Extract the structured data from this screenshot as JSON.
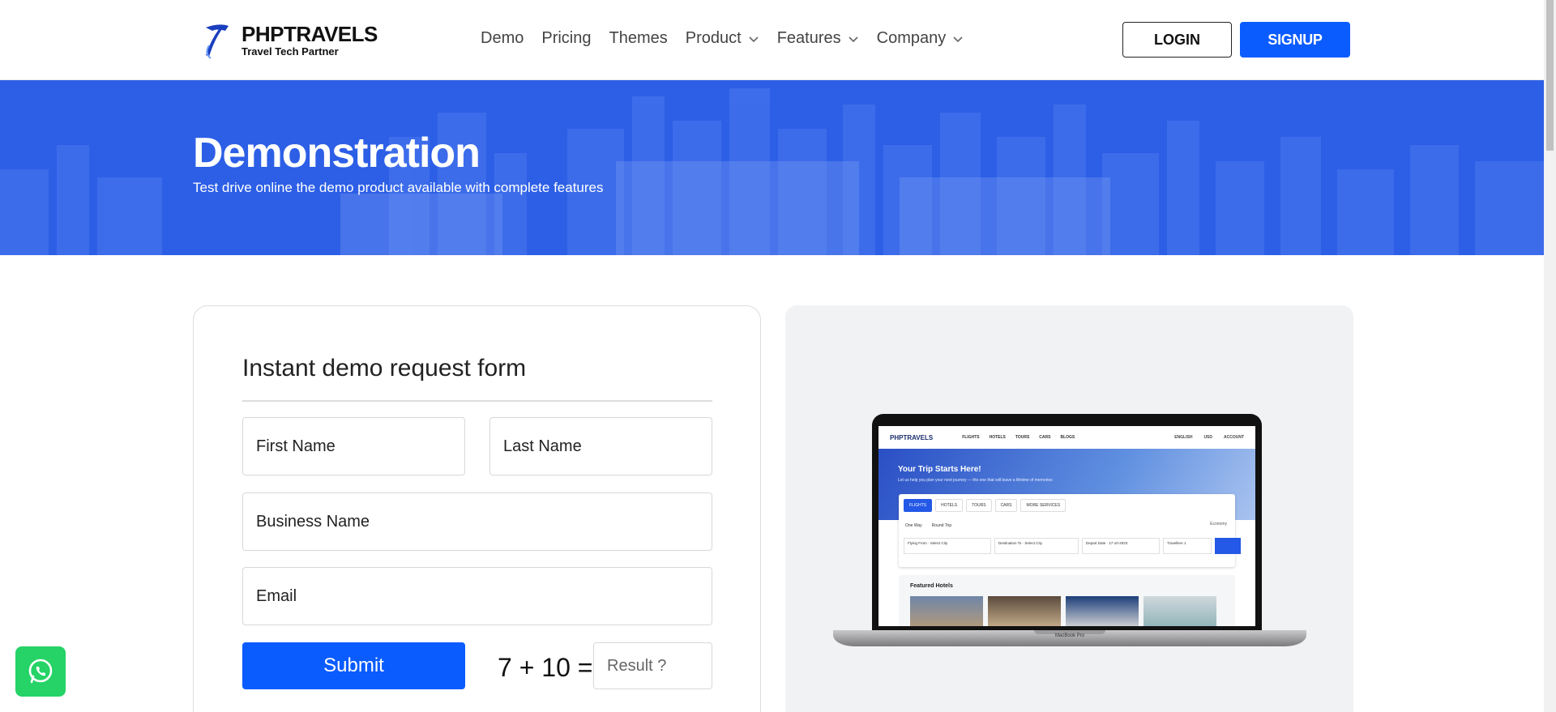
{
  "brand": {
    "name": "PHPTRAVELS",
    "tagline": "Travel Tech Partner"
  },
  "nav": {
    "items": [
      {
        "label": "Demo",
        "dropdown": false
      },
      {
        "label": "Pricing",
        "dropdown": false
      },
      {
        "label": "Themes",
        "dropdown": false
      },
      {
        "label": "Product",
        "dropdown": true
      },
      {
        "label": "Features",
        "dropdown": true
      },
      {
        "label": "Company",
        "dropdown": true
      }
    ],
    "login_label": "LOGIN",
    "signup_label": "SIGNUP"
  },
  "hero": {
    "title": "Demonstration",
    "subtitle": "Test drive online the demo product available with complete features"
  },
  "form": {
    "title": "Instant demo request form",
    "first_name_placeholder": "First Name",
    "last_name_placeholder": "Last Name",
    "business_placeholder": "Business Name",
    "email_placeholder": "Email",
    "submit_label": "Submit",
    "captcha_question": "7 + 10 =",
    "captcha_placeholder": "Result ?"
  },
  "preview": {
    "site_brand": "PHPTRAVELS",
    "site_nav": [
      "FLIGHTS",
      "HOTELS",
      "TOURS",
      "CARS",
      "BLOGS"
    ],
    "site_right": [
      "ENGLISH",
      "USD",
      "ACCOUNT"
    ],
    "hero_title": "Your Trip Starts Here!",
    "hero_subtitle": "Let us help you plan your next journey — the one that will leave a lifetime of memories",
    "tabs": [
      "FLIGHTS",
      "HOTELS",
      "TOURS",
      "CARS",
      "MORE SERVICES"
    ],
    "trip_types": [
      "One Way",
      "Round Trip"
    ],
    "cabin_class": "Economy",
    "fields": [
      "Flying From · Select City",
      "Destination To · Select City",
      "Depart Date · 17-10-2023",
      "Travellers 1"
    ],
    "featured_title": "Featured Hotels",
    "device_label": "MacBook Pro"
  },
  "colors": {
    "primary": "#0a5cff",
    "hero_bg": "#2d5fe6",
    "whatsapp": "#25d366"
  }
}
